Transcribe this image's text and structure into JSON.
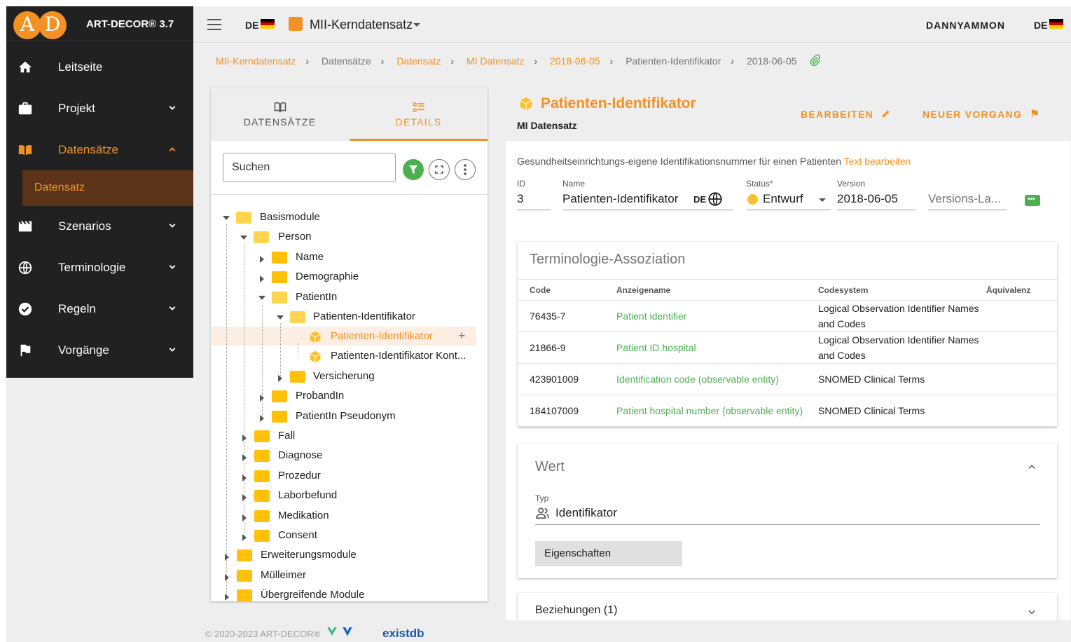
{
  "app": {
    "title": "ART-DECOR® 3.7",
    "logo_letters": [
      "A",
      "D"
    ]
  },
  "sidebar": {
    "items": [
      {
        "label": "Leitseite",
        "icon": "home-icon"
      },
      {
        "label": "Projekt",
        "icon": "briefcase-icon"
      },
      {
        "label": "Datensätze",
        "icon": "book-icon",
        "active": true
      },
      {
        "label": "Szenarios",
        "icon": "clapperboard-icon"
      },
      {
        "label": "Terminologie",
        "icon": "globe-icon"
      },
      {
        "label": "Regeln",
        "icon": "check-circle-icon"
      },
      {
        "label": "Vorgänge",
        "icon": "flag-icon"
      }
    ],
    "sub_item": "Datensatz"
  },
  "topbar": {
    "lang": "DE",
    "project": "MII-Kerndatensatz",
    "user": "DANNYAMMON",
    "user_lang": "DE"
  },
  "breadcrumb": [
    "MII-Kerndatensatz",
    "Datensätze",
    "Datensatz",
    "MI Datensatz",
    "2018-06-05",
    "Patienten-Identifikator",
    "2018-06-05"
  ],
  "left_panel": {
    "tabs": [
      "DATENSÄTZE",
      "DETAILS"
    ],
    "search_placeholder": "Suchen",
    "tree": [
      "Basismodule",
      "Person",
      "Name",
      "Demographie",
      "PatientIn",
      "Patienten-Identifikator",
      "Patienten-Identifikator",
      "Patienten-Identifikator Kont...",
      "Versicherung",
      "ProbandIn",
      "PatientIn Pseudonym",
      "Fall",
      "Diagnose",
      "Prozedur",
      "Laborbefund",
      "Medikation",
      "Consent",
      "Erweiterungsmodule",
      "Mülleimer",
      "Übergreifende Module"
    ]
  },
  "detail": {
    "title": "Patienten-Identifikator",
    "subtitle": "MI Datensatz",
    "edit_label": "BEARBEITEN",
    "new_issue_label": "NEUER VORGANG",
    "description": "Gesundheitseinrichtungs-eigene Identifikationsnummer für einen Patienten",
    "edit_text_link": "Text bearbeiten",
    "fields": {
      "id_label": "ID",
      "id_value": "3",
      "name_label": "Name",
      "name_value": "Patienten-Identifikator",
      "name_lang": "DE",
      "status_label": "Status",
      "status_required": "*",
      "status_value": "Entwurf",
      "version_label": "Version",
      "version_value": "2018-06-05",
      "version_label_placeholder": "Versions-La..."
    }
  },
  "terminology": {
    "title": "Terminologie-Assoziation",
    "headers": [
      "Code",
      "Anzeigename",
      "Codesystem",
      "Äquivalenz"
    ],
    "rows": [
      {
        "code": "76435-7",
        "name": "Patient identifier",
        "system": "Logical Observation Identifier Names and Codes"
      },
      {
        "code": "21866-9",
        "name": "Patient ID.hospital",
        "system": "Logical Observation Identifier Names and Codes"
      },
      {
        "code": "423901009",
        "name": "Identification code (observable entity)",
        "system": "SNOMED Clinical Terms"
      },
      {
        "code": "184107009",
        "name": "Patient hospital number (observable entity)",
        "system": "SNOMED Clinical Terms"
      }
    ]
  },
  "wert": {
    "title": "Wert",
    "type_label": "Typ",
    "type_value": "Identifikator",
    "properties_button": "Eigenschaften"
  },
  "relations": {
    "label": "Beziehungen (1)"
  },
  "footer": {
    "copyright": "© 2020-2023 ART-DECOR®",
    "existdb": "existdb"
  },
  "colors": {
    "accent": "#f39224",
    "green": "#4caf50",
    "sidebar_bg": "#212121"
  }
}
